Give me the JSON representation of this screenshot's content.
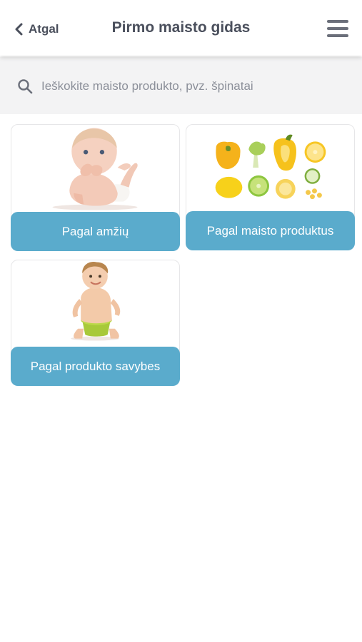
{
  "header": {
    "back_label": "Atgal",
    "title": "Pirmo maisto gidas"
  },
  "search": {
    "placeholder": "Ieškokite maisto produkto, pvz. špinatai"
  },
  "categories": [
    {
      "label": "Pagal amžių",
      "image": "baby-lying-photo"
    },
    {
      "label": "Pagal maisto produktus",
      "image": "yellow-green-vegetables-photo"
    },
    {
      "label": "Pagal produkto savybes",
      "image": "toddler-on-potty-photo"
    }
  ],
  "colors": {
    "accent": "#5aabcc",
    "text": "#4a4f5c",
    "search_background": "#f3f3f4"
  }
}
